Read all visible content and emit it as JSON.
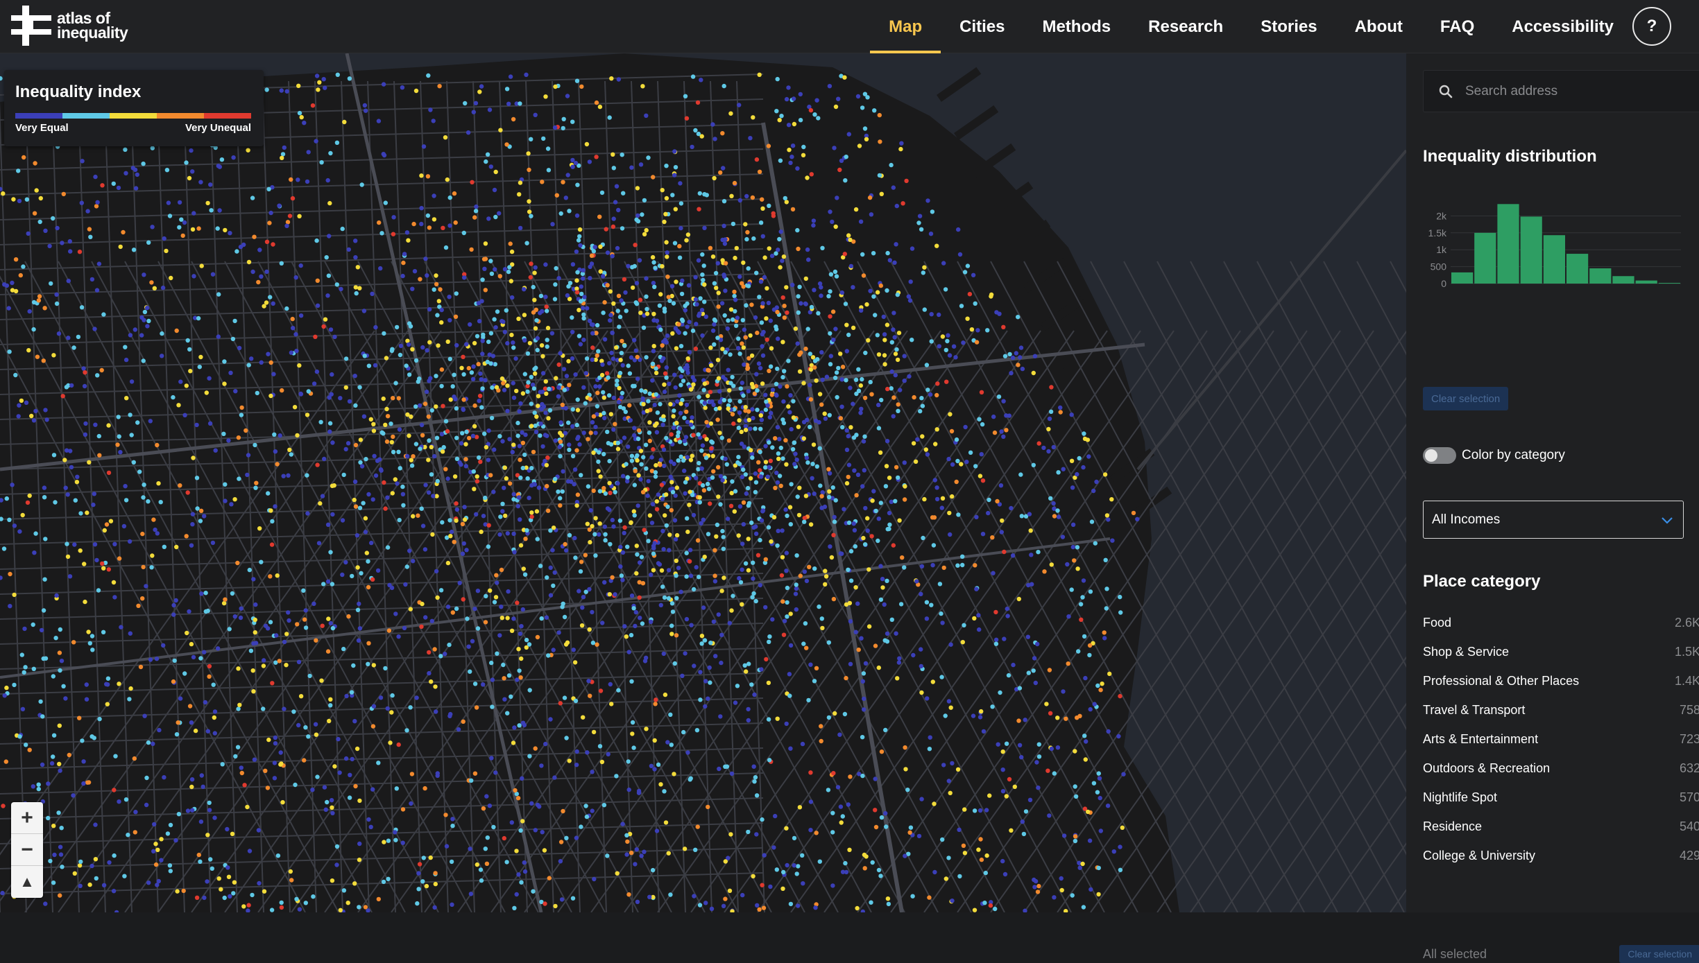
{
  "brand": {
    "line1": "atlas of",
    "line2": "inequality"
  },
  "nav": {
    "items": [
      {
        "label": "Map",
        "active": true
      },
      {
        "label": "Cities"
      },
      {
        "label": "Methods"
      },
      {
        "label": "Research"
      },
      {
        "label": "Stories"
      },
      {
        "label": "About"
      },
      {
        "label": "FAQ"
      },
      {
        "label": "Accessibility"
      }
    ],
    "help_label": "?"
  },
  "legend": {
    "title": "Inequality index",
    "low_label": "Very Equal",
    "high_label": "Very Unequal",
    "colors": [
      "#3b3fb8",
      "#5fc9e6",
      "#f3dc3b",
      "#f28a2e",
      "#e03a2f"
    ]
  },
  "zoom": {
    "in_label": "+",
    "out_label": "−",
    "compass_label": "▲"
  },
  "panel": {
    "search_placeholder": "Search address",
    "distribution_title": "Inequality distribution",
    "histogram": {
      "type": "bar",
      "y_ticks": [
        "2k",
        "1.5k",
        "1k",
        "500",
        "0"
      ],
      "values": [
        330,
        1500,
        2350,
        1980,
        1430,
        880,
        450,
        220,
        90,
        20
      ],
      "ylim": [
        0,
        2500
      ],
      "color": "#2e9e63"
    },
    "clear_selection_label": "Clear selection",
    "color_by_category_label": "Color by category",
    "income_select": "All Incomes",
    "place_category_title": "Place category",
    "categories": [
      {
        "label": "Food",
        "count": "2.6K"
      },
      {
        "label": "Shop & Service",
        "count": "1.5K"
      },
      {
        "label": "Professional & Other Places",
        "count": "1.4K"
      },
      {
        "label": "Travel & Transport",
        "count": "758"
      },
      {
        "label": "Arts & Entertainment",
        "count": "723"
      },
      {
        "label": "Outdoors & Recreation",
        "count": "632"
      },
      {
        "label": "Nightlife Spot",
        "count": "570"
      },
      {
        "label": "Residence",
        "count": "540"
      },
      {
        "label": "College & University",
        "count": "429"
      }
    ],
    "all_selected_label": "All selected",
    "category_clear_label": "Clear selection"
  }
}
